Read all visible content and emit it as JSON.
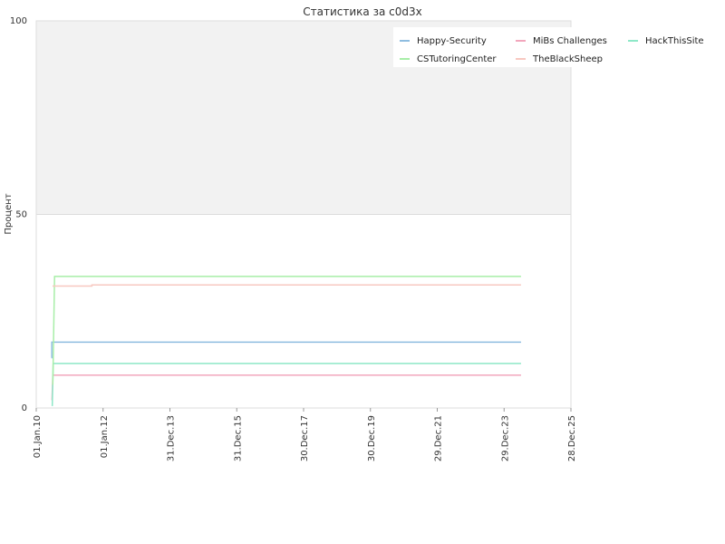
{
  "chart_data": {
    "type": "line",
    "title": "Статистика за c0d3x",
    "xlabel": "",
    "ylabel": "Процент",
    "ylim": [
      0,
      100
    ],
    "xlim": [
      "2010-01-01",
      "2025-12-28"
    ],
    "yticks": [
      0,
      50,
      100
    ],
    "xticks": [
      "01.Jan.10",
      "01.Jan.12",
      "31.Dec.13",
      "31.Dec.15",
      "30.Dec.17",
      "30.Dec.19",
      "29.Dec.21",
      "29.Dec.23",
      "28.Dec.25"
    ],
    "grid": true,
    "legend_position": "top-right",
    "series": [
      {
        "name": "Happy-Security",
        "color": "#8fbde0",
        "points": [
          [
            "2010-06-15",
            13
          ],
          [
            "2010-06-20",
            13
          ],
          [
            "2010-06-20",
            17
          ],
          [
            "2024-07-01",
            17
          ]
        ]
      },
      {
        "name": "MiBs Challenges",
        "color": "#f2a6bc",
        "points": [
          [
            "2010-06-22",
            2
          ],
          [
            "2010-07-01",
            8.5
          ],
          [
            "2024-07-01",
            8.5
          ]
        ]
      },
      {
        "name": "HackThisSite",
        "color": "#8ee8c8",
        "points": [
          [
            "2010-06-25",
            0.5
          ],
          [
            "2010-07-05",
            11.5
          ],
          [
            "2024-07-01",
            11.5
          ]
        ]
      },
      {
        "name": "CSTutoringCenter",
        "color": "#a8eea8",
        "points": [
          [
            "2010-07-01",
            6
          ],
          [
            "2010-07-20",
            34
          ],
          [
            "2024-07-01",
            34
          ]
        ]
      },
      {
        "name": "TheBlackSheep",
        "color": "#f7c8c0",
        "points": [
          [
            "2010-06-28",
            31.5
          ],
          [
            "2011-09-01",
            31.5
          ],
          [
            "2011-09-01",
            31.8
          ],
          [
            "2024-07-01",
            31.8
          ]
        ]
      }
    ]
  }
}
